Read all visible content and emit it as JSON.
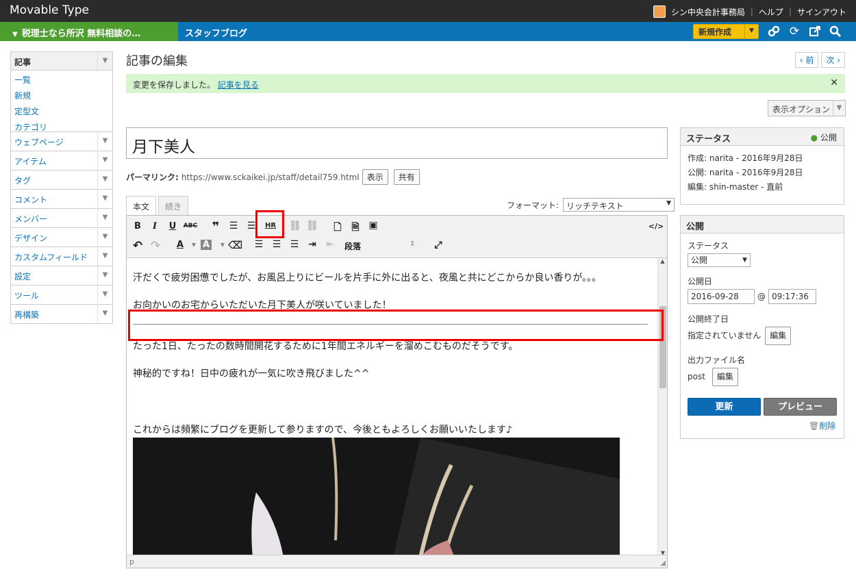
{
  "app": {
    "logo": "Movable Type"
  },
  "user": {
    "name": "シン中央会計事務局",
    "help": "ヘルプ",
    "signout": "サインアウト"
  },
  "nav": {
    "site": "税理士なら所沢 無料相談の…",
    "blog": "スタッフブログ",
    "new_button": "新規作成"
  },
  "sidebar": {
    "main": "記事",
    "sub": [
      "一覧",
      "新規",
      "定型文",
      "カテゴリ"
    ],
    "items": [
      "ウェブページ",
      "アイテム",
      "タグ",
      "コメント",
      "メンバー",
      "デザイン",
      "カスタムフィールド",
      "設定",
      "ツール",
      "再構築"
    ]
  },
  "page": {
    "title": "記事の編集",
    "prev": "‹ 前",
    "next": "次 ›",
    "message": "変更を保存しました。",
    "message_link": "記事を見る",
    "display_options": "表示オプション",
    "entry_title": "月下美人",
    "permalink_label": "パーマリンク:",
    "permalink_url": "https://www.sckaikei.jp/staff/detail759.html",
    "view_button": "表示",
    "share_button": "共有"
  },
  "editor": {
    "tabs": [
      "本文",
      "続き"
    ],
    "format_label": "フォーマット:",
    "format_value": "リッチテキスト",
    "paragraph_select": "段落",
    "hr_label": "HR",
    "source_label": "</>",
    "status_path": "p",
    "paragraphs": [
      "汗だくで疲労困憊でしたが、お風呂上りにビールを片手に外に出ると、夜風と共にどこからか良い香りが。。。",
      "お向かいのお宅からいただいた月下美人が咲いていました！",
      "たった1日、たったの数時間開花するために1年間エネルギーを溜めこむものだそうです。",
      "神秘的ですね！日中の疲れが一気に吹き飛びました^^",
      "これからは頻繁にブログを更新して参りますので、今後ともよろしくお願いいたします♪"
    ]
  },
  "status_panel": {
    "title": "ステータス",
    "badge": "公開",
    "created": "作成: narita - 2016年9月28日",
    "published": "公開: narita - 2016年9月28日",
    "edited": "編集: shin-master - 直前"
  },
  "publish_panel": {
    "title": "公開",
    "status_label": "ステータス",
    "status_value": "公開",
    "date_label": "公開日",
    "date_value": "2016-09-28",
    "time_value": "09:17:36",
    "end_label": "公開終了日",
    "end_value": "指定されていません",
    "edit_label": "編集",
    "file_label": "出力ファイル名",
    "file_value": "post",
    "update_button": "更新",
    "preview_button": "プレビュー",
    "delete_link": "削除"
  },
  "colors": {
    "topbar": "#2b2b2b",
    "navbar": "#0b74b7",
    "site_crumb": "#4d9e2e",
    "new_button": "#f5c20a",
    "callout": "#ee0000"
  }
}
